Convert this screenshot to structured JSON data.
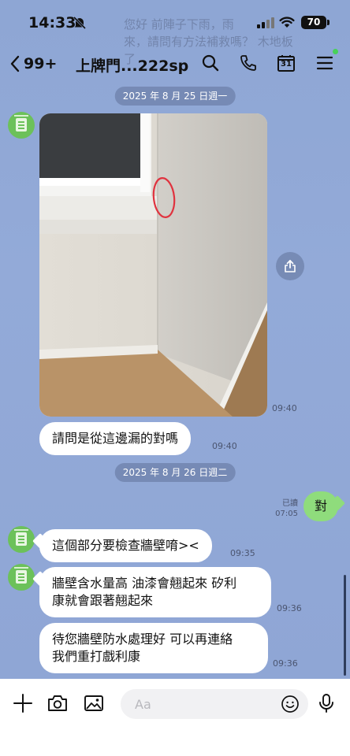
{
  "status_bar": {
    "time": "14:33",
    "battery": "70"
  },
  "background_preview": [
    "您好 前陣子下雨，雨",
    "來，請問有方法補救嗎？ 木地板",
    "了"
  ],
  "header": {
    "back_count": "99+",
    "title": "上牌門...222sp",
    "calendar_day": "31"
  },
  "messages": {
    "date1": "2025 年 8 月 25 日週一",
    "photo_time": "09:40",
    "question": "請問是從這邊漏的對嗎",
    "question_time": "09:40",
    "date2": "2025 年 8 月 26 日週二",
    "my_reply": "對",
    "my_read": "已讀",
    "my_time": "07:05",
    "reply1": "這個部分要檢查牆壁唷><",
    "reply1_time": "09:35",
    "reply2_line1": "牆壁含水量高 油漆會翹起來 矽利",
    "reply2_line2": "康就會跟著翹起來",
    "reply2_time": "09:36",
    "reply3_line1": "待您牆壁防水處理好 可以再連絡",
    "reply3_line2": "我們重打戲利康",
    "reply3_time": "09:36"
  },
  "input": {
    "placeholder": "Aa"
  },
  "colors": {
    "chat_bg": "#8fa7d6",
    "my_bubble": "#8fdc7c",
    "avatar": "#6cc15a"
  }
}
